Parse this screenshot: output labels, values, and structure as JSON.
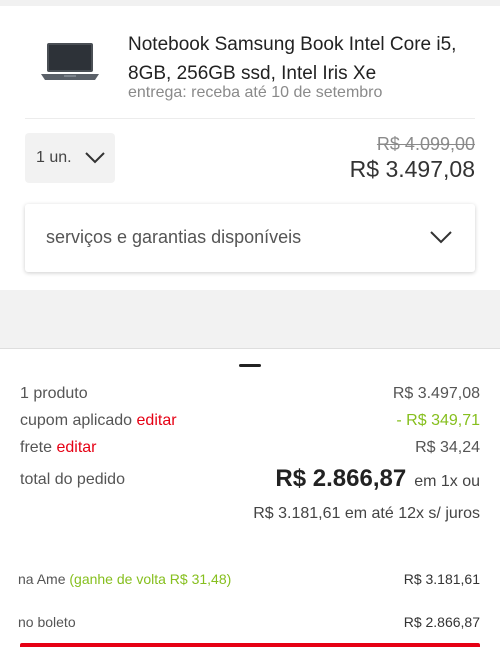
{
  "product": {
    "name": "Notebook Samsung Book Intel Core i5, 8GB, 256GB ssd, Intel Iris Xe",
    "delivery": "entrega: receba até 10 de setembro",
    "quantity": "1 un.",
    "old_price": "R$ 4.099,00",
    "price": "R$ 3.497,08"
  },
  "services": {
    "label": "serviços e garantias disponíveis"
  },
  "summary": {
    "products_label": "1 produto",
    "products_value": "R$ 3.497,08",
    "coupon_label": "cupom aplicado",
    "coupon_edit": "editar",
    "coupon_value": "- R$ 349,71",
    "shipping_label": "frete",
    "shipping_edit": "editar",
    "shipping_value": "R$ 34,24",
    "total_label": "total do pedido",
    "total_value": "R$ 2.866,87",
    "total_installment": "em 1x ou",
    "installments": "R$ 3.181,61 em até 12x s/ juros"
  },
  "payment": {
    "ame_label": "na Ame",
    "ame_cashback": "(ganhe de volta R$ 31,48)",
    "ame_value": "R$ 3.181,61",
    "boleto_label": "no boleto",
    "boleto_value": "R$ 2.866,87"
  },
  "colors": {
    "accent_red": "#e60014",
    "cashback_green": "#86bf1e"
  },
  "icons": {
    "quantity": "chevron-down-icon",
    "services": "chevron-down-icon",
    "product": "laptop-thumbnail"
  }
}
